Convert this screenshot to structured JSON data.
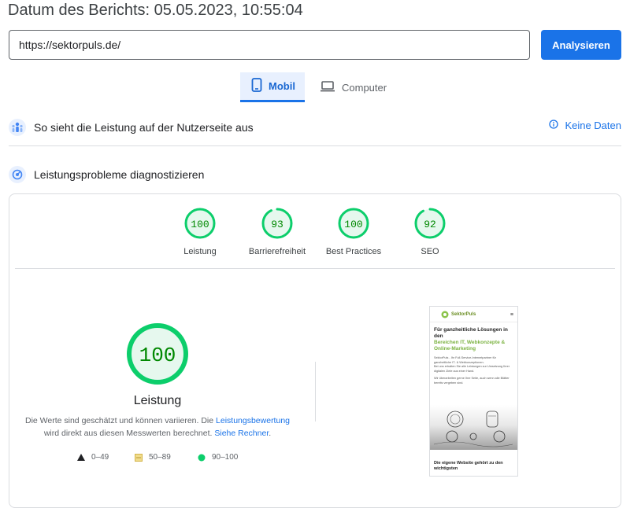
{
  "header": {
    "report_date": "Datum des Berichts: 05.05.2023, 10:55:04"
  },
  "search": {
    "url_value": "https://sektorpuls.de/",
    "analyze_label": "Analysieren"
  },
  "tabs": [
    {
      "label": "Mobil",
      "active": true
    },
    {
      "label": "Computer",
      "active": false
    }
  ],
  "field_data": {
    "title": "So sieht die Leistung auf der Nutzerseite aus",
    "status": "Keine Daten"
  },
  "lab": {
    "title": "Leistungsprobleme diagnostizieren"
  },
  "scores": [
    {
      "label": "Leistung",
      "value": 100
    },
    {
      "label": "Barrierefreiheit",
      "value": 93
    },
    {
      "label": "Best Practices",
      "value": 100
    },
    {
      "label": "SEO",
      "value": 92
    }
  ],
  "main_score": {
    "value": 100,
    "label": "Leistung"
  },
  "note": {
    "text1": "Die Werte sind geschätzt und können variieren. Die ",
    "link1": "Leistungsbewertung",
    "text2": " wird direkt aus diesen Messwerten berechnet. ",
    "link2": "Siehe Rechner",
    "text3": "."
  },
  "legend": [
    {
      "label": "0–49",
      "color": "#202124"
    },
    {
      "label": "50–89",
      "color": "#d4b44a"
    },
    {
      "label": "90–100",
      "color": "#0cce6b"
    }
  ],
  "preview": {
    "brand": "SektorPuls",
    "headline_black": "Für ganzheitliche Lösungen in den",
    "headline_green": "Bereichen IT, Webkonzepte & Online-Marketing",
    "body1": "SektorPuls - Ihr Full-Service-Internetpartner für ganzheitliche IT- & Webkonzeptionen.",
    "body2": "Bei uns erhalten Sie alle Leistungen zur Umsetzung Ihrer digitalen Ziele aus einer Hand.",
    "body3": "Wir überarbeiten gerne Ihre Seite, auch wenn alle Blätter bereits vergeben sind.",
    "footer": "Die eigene Website gehört zu den wichtigsten"
  },
  "colors": {
    "accent": "#1a73e8",
    "good": "#0cce6b",
    "good_text": "#008800",
    "good_bg": "#e6f8ee"
  }
}
